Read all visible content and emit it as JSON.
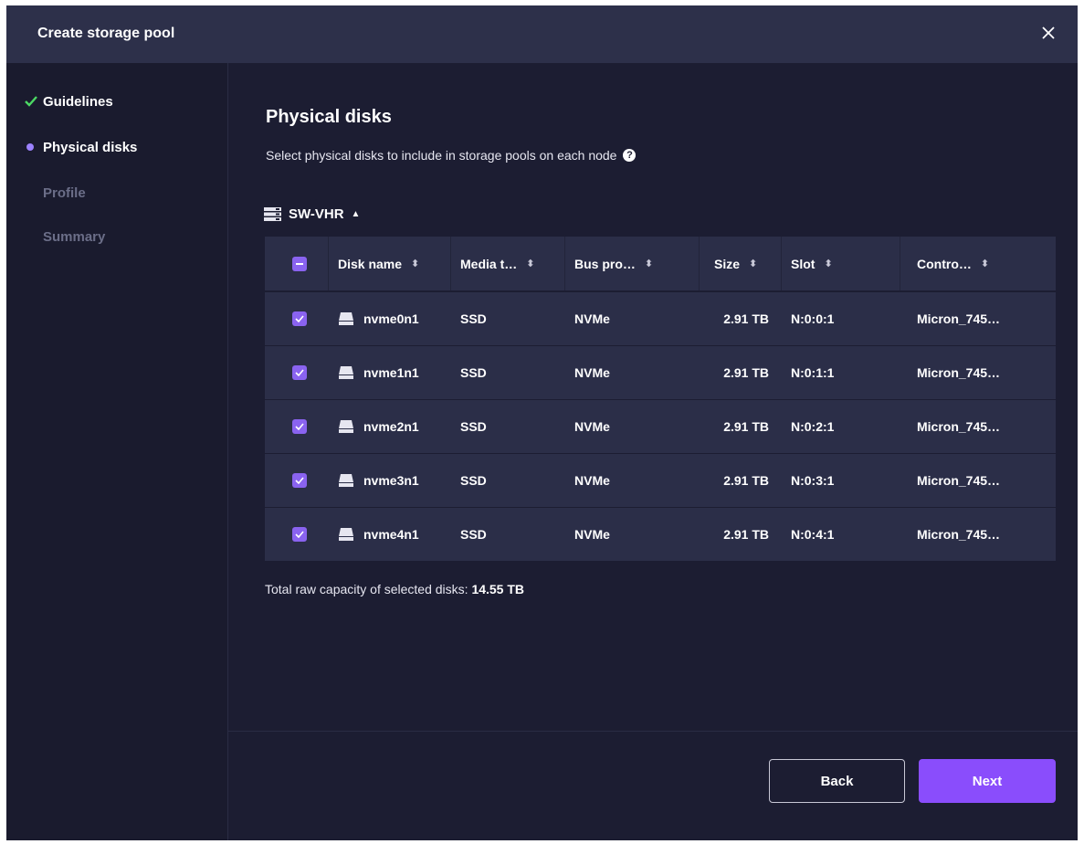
{
  "dialog": {
    "title": "Create storage pool"
  },
  "steps": [
    {
      "label": "Guidelines",
      "state": "done"
    },
    {
      "label": "Physical disks",
      "state": "active"
    },
    {
      "label": "Profile",
      "state": "pending"
    },
    {
      "label": "Summary",
      "state": "pending"
    }
  ],
  "content": {
    "heading": "Physical disks",
    "subtitle": "Select physical disks to include in storage pools on each node",
    "help_glyph": "?",
    "node_name": "SW-VHR"
  },
  "table": {
    "headers": {
      "disk_name": "Disk name",
      "media_type": "Media t…",
      "bus_protocol": "Bus pro…",
      "size": "Size",
      "slot": "Slot",
      "controller": "Contro…"
    },
    "rows": [
      {
        "name": "nvme0n1",
        "media": "SSD",
        "bus": "NVMe",
        "size": "2.91 TB",
        "slot": "N:0:0:1",
        "controller": "Micron_745…"
      },
      {
        "name": "nvme1n1",
        "media": "SSD",
        "bus": "NVMe",
        "size": "2.91 TB",
        "slot": "N:0:1:1",
        "controller": "Micron_745…"
      },
      {
        "name": "nvme2n1",
        "media": "SSD",
        "bus": "NVMe",
        "size": "2.91 TB",
        "slot": "N:0:2:1",
        "controller": "Micron_745…"
      },
      {
        "name": "nvme3n1",
        "media": "SSD",
        "bus": "NVMe",
        "size": "2.91 TB",
        "slot": "N:0:3:1",
        "controller": "Micron_745…"
      },
      {
        "name": "nvme4n1",
        "media": "SSD",
        "bus": "NVMe",
        "size": "2.91 TB",
        "slot": "N:0:4:1",
        "controller": "Micron_745…"
      }
    ]
  },
  "summary": {
    "label": "Total raw capacity of selected disks:",
    "value": "14.55 TB"
  },
  "footer": {
    "back_label": "Back",
    "next_label": "Next"
  },
  "colors": {
    "background": "#1c1d32",
    "header": "#2d304a",
    "row": "#2b2e48",
    "accent": "#8a4dfc",
    "checkbox": "#8a63f0",
    "success": "#4cd964"
  },
  "icons": {
    "close": "close-icon",
    "done_step": "checkmark-icon",
    "active_step": "dot-icon",
    "help": "help-icon",
    "server": "server-icon",
    "caret": "caret-up-icon",
    "sort": "sort-icon",
    "disk": "disk-icon"
  }
}
